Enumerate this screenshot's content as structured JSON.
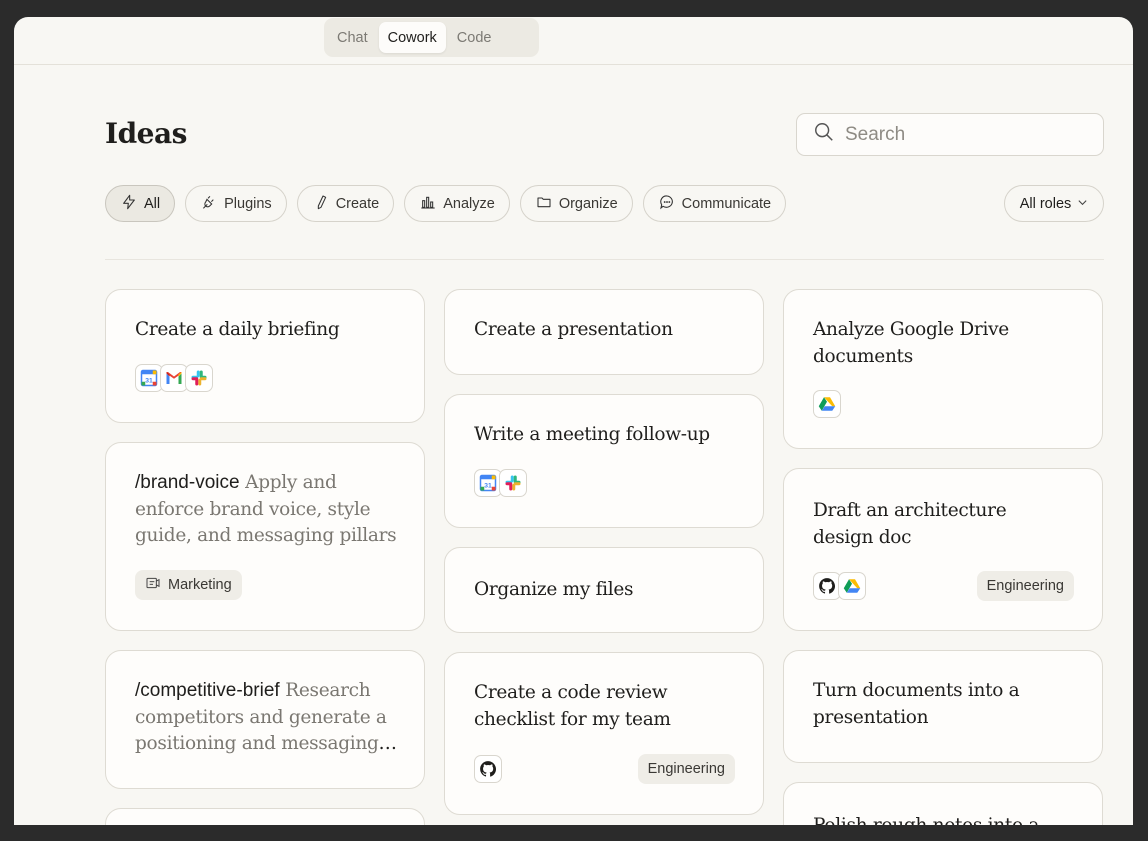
{
  "tabs": [
    {
      "label": "Chat",
      "active": false
    },
    {
      "label": "Cowork",
      "active": true
    },
    {
      "label": "Code",
      "active": false
    }
  ],
  "page": {
    "title": "Ideas"
  },
  "search": {
    "placeholder": "Search"
  },
  "filters": [
    {
      "label": "All",
      "icon": "bolt-icon",
      "active": true
    },
    {
      "label": "Plugins",
      "icon": "plug-icon"
    },
    {
      "label": "Create",
      "icon": "pen-icon"
    },
    {
      "label": "Analyze",
      "icon": "bar-chart-icon"
    },
    {
      "label": "Organize",
      "icon": "folder-icon"
    },
    {
      "label": "Communicate",
      "icon": "chat-bubble-icon"
    }
  ],
  "roles": {
    "label": "All roles"
  },
  "cards": [
    {
      "title": "Create a daily briefing",
      "integrations": [
        "google-calendar-icon",
        "gmail-icon",
        "slack-icon"
      ]
    },
    {
      "command": "/brand-voice",
      "description": "Apply and enforce brand voice, style guide, and messaging pillars",
      "tag": "Marketing"
    },
    {
      "command": "/competitive-brief",
      "description": "Research competitors and generate a positioning and messaging brief"
    },
    {
      "title": "Create a presentation"
    },
    {
      "title": "Write a meeting follow-up",
      "integrations": [
        "google-calendar-icon",
        "slack-icon"
      ]
    },
    {
      "title": "Organize my files"
    },
    {
      "title": "Create a code review checklist for my team",
      "integrations": [
        "github-icon"
      ],
      "tag": "Engineering"
    },
    {
      "title": "Analyze Google Drive documents",
      "integrations": [
        "google-drive-icon"
      ]
    },
    {
      "title": "Draft an architecture design doc",
      "integrations": [
        "github-icon",
        "google-drive-icon"
      ],
      "tag": "Engineering"
    },
    {
      "title": "Turn documents into a presentation"
    },
    {
      "title": "Polish rough notes into a"
    }
  ],
  "colors": {
    "background": "#f8f7f3",
    "card": "#fefdfb",
    "border": "#dedbd3",
    "frame": "#2b2b2b"
  }
}
